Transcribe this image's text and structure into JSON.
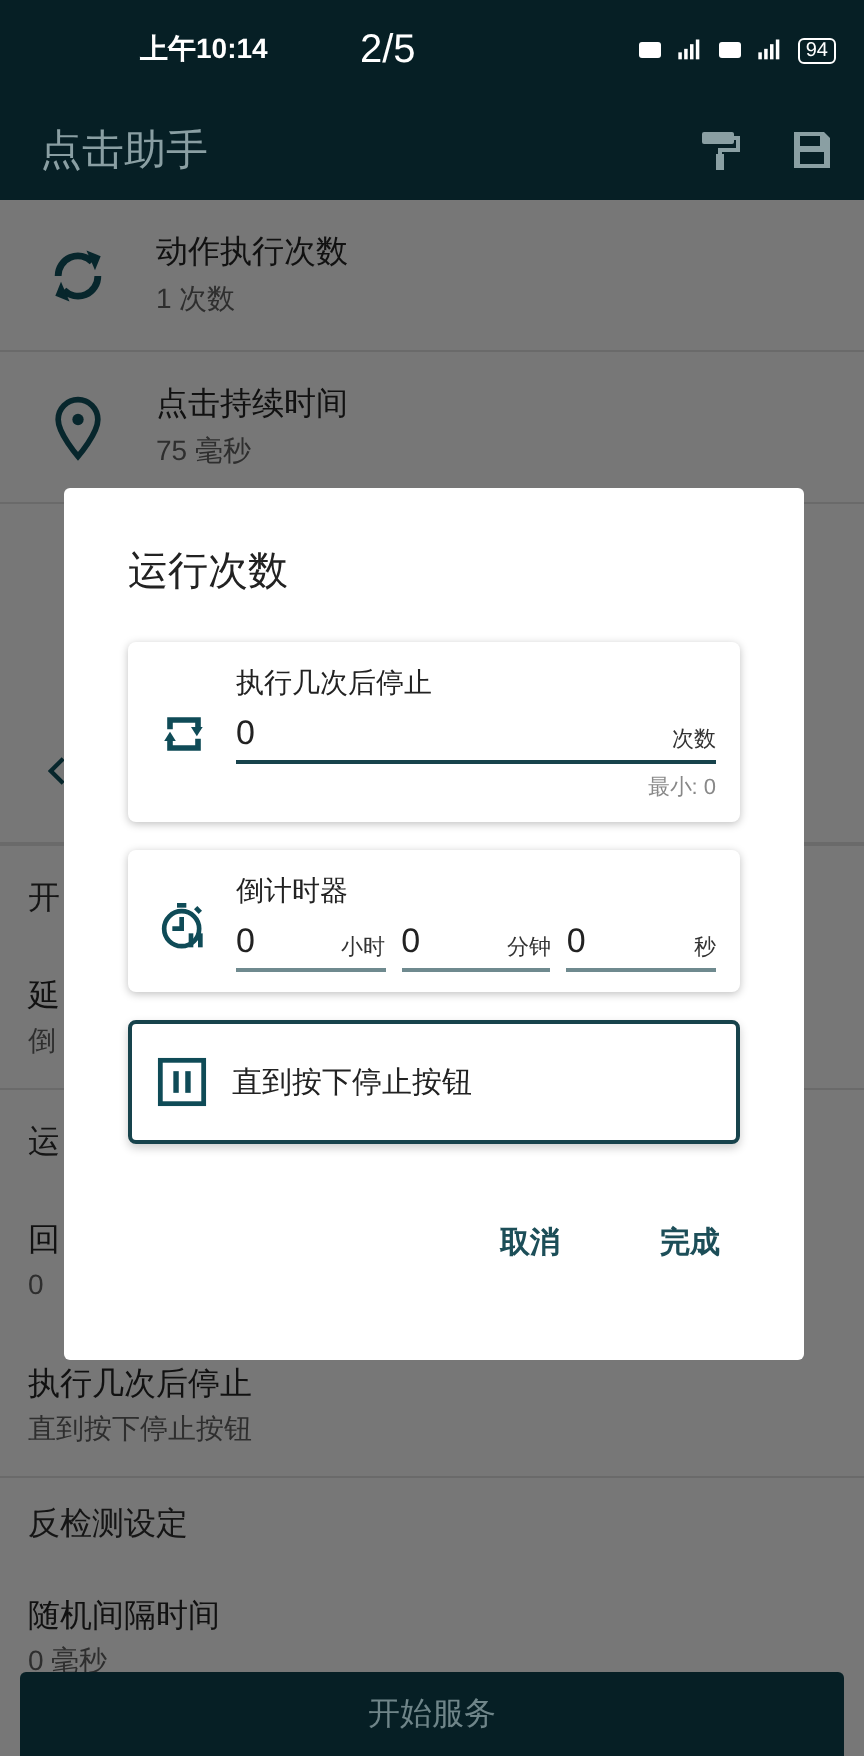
{
  "status_bar": {
    "time": "上午10:14",
    "page_counter": "2/5",
    "battery": "94"
  },
  "app_bar": {
    "title": "点击助手"
  },
  "settings": [
    {
      "kind": "item",
      "title": "动作执行次数",
      "subtitle": "1 次数"
    },
    {
      "kind": "item",
      "title": "点击持续时间",
      "subtitle": "75 毫秒"
    },
    {
      "kind": "icon_only"
    },
    {
      "kind": "section",
      "title": "开"
    },
    {
      "kind": "plain",
      "title": "延",
      "subtitle": "倒"
    },
    {
      "kind": "section",
      "title": "运"
    },
    {
      "kind": "plain",
      "title": "回",
      "subtitle": "0"
    },
    {
      "kind": "plain",
      "title": "执行几次后停止",
      "subtitle": "直到按下停止按钮"
    },
    {
      "kind": "section",
      "title": "反检测设定"
    },
    {
      "kind": "plain",
      "title": "随机间隔时间",
      "subtitle": "0 毫秒"
    }
  ],
  "dialog": {
    "title": "运行次数",
    "options": [
      {
        "kind": "count",
        "label": "执行几次后停止",
        "value": "0",
        "unit": "次数",
        "hint": "最小: 0",
        "selected": false
      },
      {
        "kind": "timer",
        "label": "倒计时器",
        "fields": [
          {
            "value": "0",
            "unit": "小时"
          },
          {
            "value": "0",
            "unit": "分钟"
          },
          {
            "value": "0",
            "unit": "秒"
          }
        ],
        "selected": false
      },
      {
        "kind": "until_stop",
        "label": "直到按下停止按钮",
        "selected": true
      }
    ],
    "buttons": [
      "取消",
      "完成"
    ]
  },
  "start_button": "开始服务"
}
